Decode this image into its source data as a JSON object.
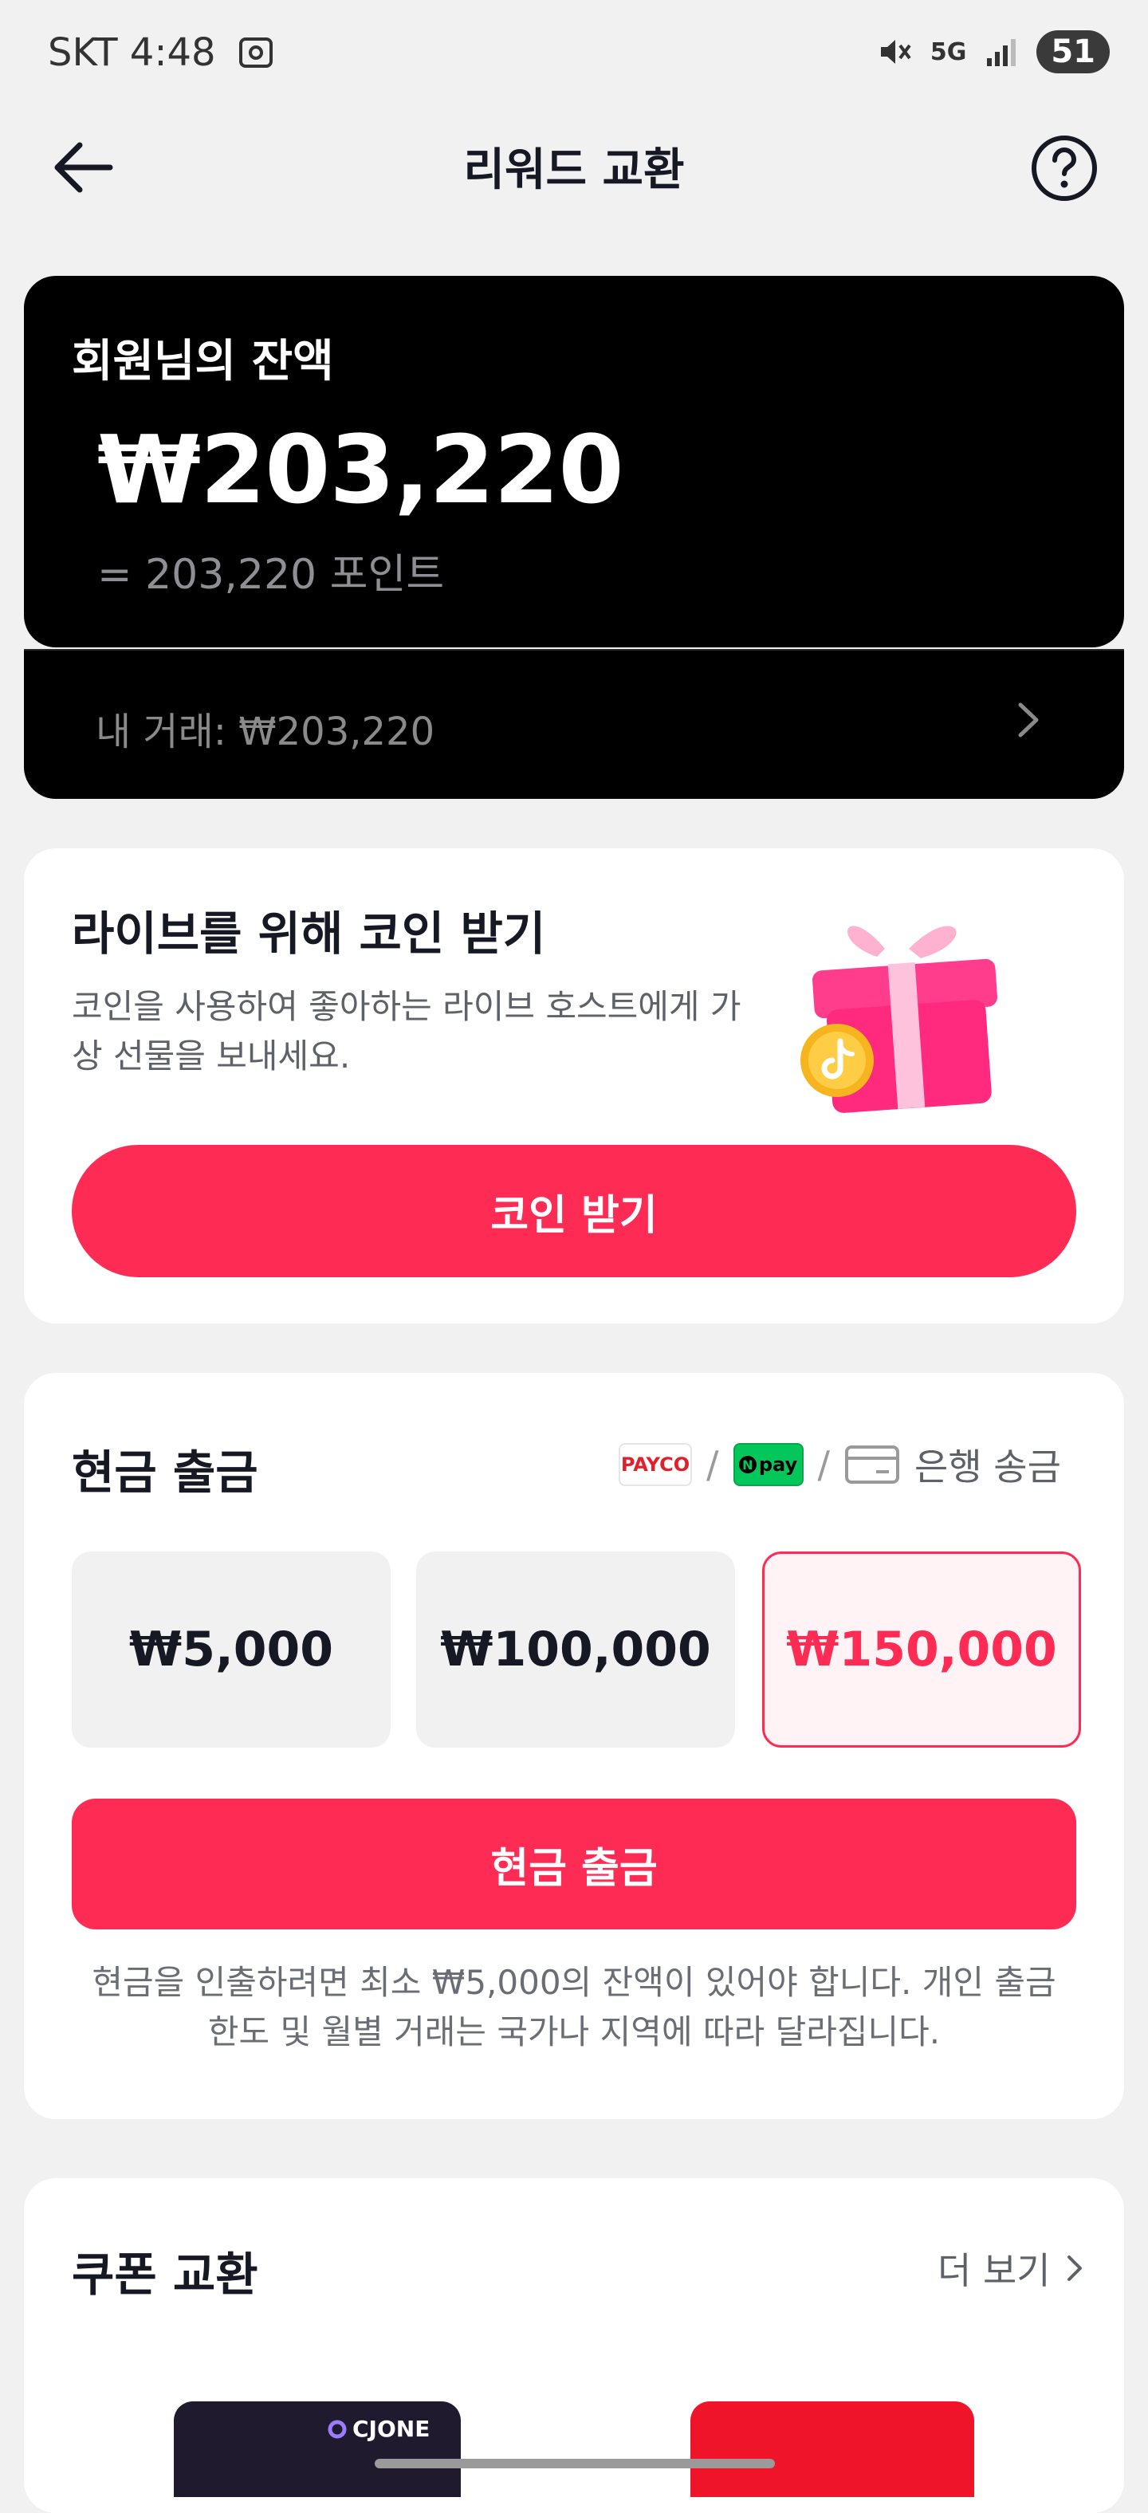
{
  "status_bar": {
    "carrier_time": "SKT 4:48",
    "network": "5G",
    "battery": "51"
  },
  "nav": {
    "title": "리워드 교환"
  },
  "balance": {
    "label": "회원님의 잔액",
    "amount": "₩203,220",
    "points": "= 203,220 포인트",
    "transactions": "내 거래: ₩203,220"
  },
  "coin_section": {
    "title": "라이브를 위해 코인 받기",
    "description": "코인을 사용하여 좋아하는 라이브 호스트에게 가상 선물을 보내세요.",
    "button": "코인 받기"
  },
  "cash_section": {
    "title": "현금 출금",
    "payco": "PAYCO",
    "npay": "pay",
    "bank": "은행 송금",
    "options": [
      "₩5,000",
      "₩100,000",
      "₩150,000"
    ],
    "selected_index": 2,
    "button": "현금 출금",
    "note": "현금을 인출하려면 최소 ₩5,000의 잔액이 있어야 합니다. 개인 출금 한도 및 월별 거래는 국가나 지역에 따라 달라집니다."
  },
  "coupon_section": {
    "title": "쿠폰 교환",
    "more": "더 보기",
    "brand": "CJONE"
  },
  "colors": {
    "accent": "#fe2c55",
    "card_dark": "#000000",
    "background": "#f1f1f2"
  }
}
